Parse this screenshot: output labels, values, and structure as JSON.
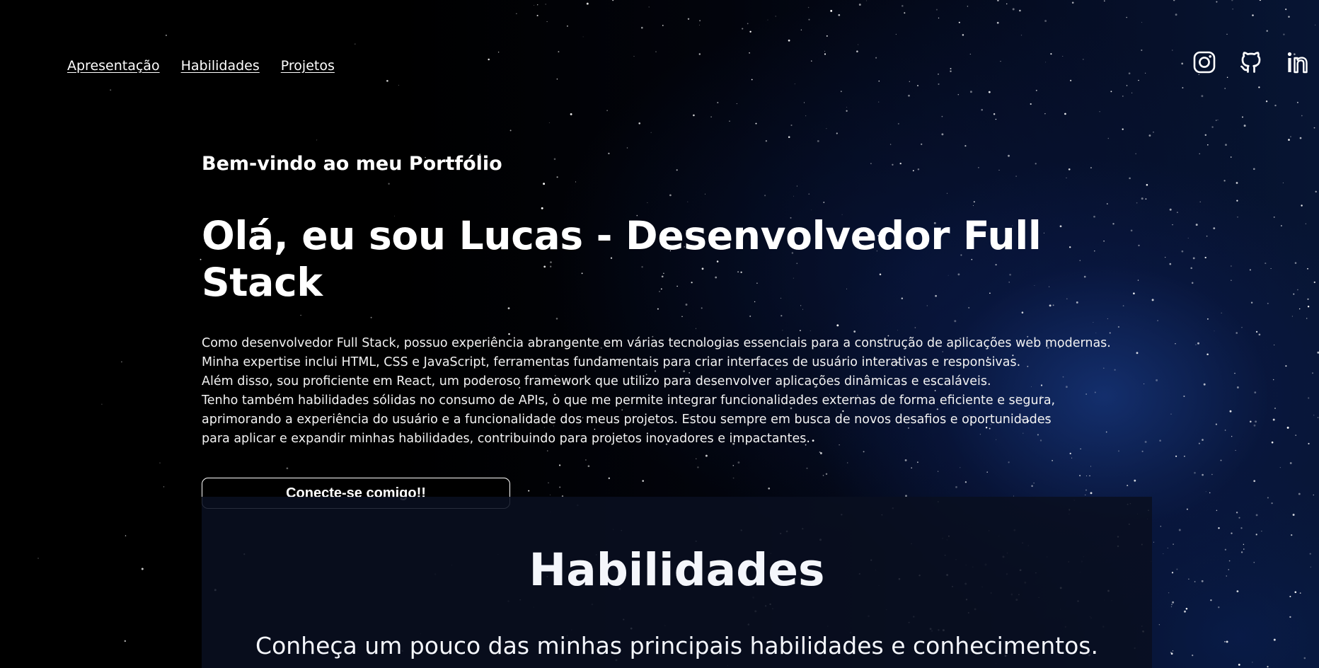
{
  "nav": {
    "links": [
      {
        "label": "Apresentação"
      },
      {
        "label": "Habilidades"
      },
      {
        "label": "Projetos"
      }
    ]
  },
  "social": {
    "icons": [
      "instagram-icon",
      "github-icon",
      "linkedin-icon"
    ]
  },
  "hero": {
    "welcome": "Bem-vindo ao meu Portfólio",
    "headline": "Olá, eu sou Lucas - Desenvolvedor Full Stack",
    "paragraph_lines": [
      "Como desenvolvedor Full Stack, possuo experiência abrangente em várias tecnologias essenciais para a construção de aplicações web modernas.",
      "Minha expertise inclui HTML, CSS e JavaScript, ferramentas fundamentais para criar interfaces de usuário interativas e responsivas.",
      "Além disso, sou proficiente em React, um poderoso framework que utilizo para desenvolver aplicações dinâmicas e escaláveis.",
      "Tenho também habilidades sólidas no consumo de APIs, o que me permite integrar funcionalidades externas de forma eficiente e segura,",
      "aprimorando a experiência do usuário e a funcionalidade dos meus projetos. Estou sempre em busca de novos desafios e oportunidades",
      "para aplicar e expandir minhas habilidades, contribuindo para projetos inovadores e impactantes."
    ],
    "cta_label": "Conecte-se comigo!!"
  },
  "skills": {
    "title": "Habilidades",
    "subtitle": "Conheça um pouco das minhas principais habilidades e conhecimentos."
  },
  "colors": {
    "background": "#000000",
    "text": "#ffffff",
    "section_bg": "#090f20",
    "nebula": "#16347a"
  }
}
